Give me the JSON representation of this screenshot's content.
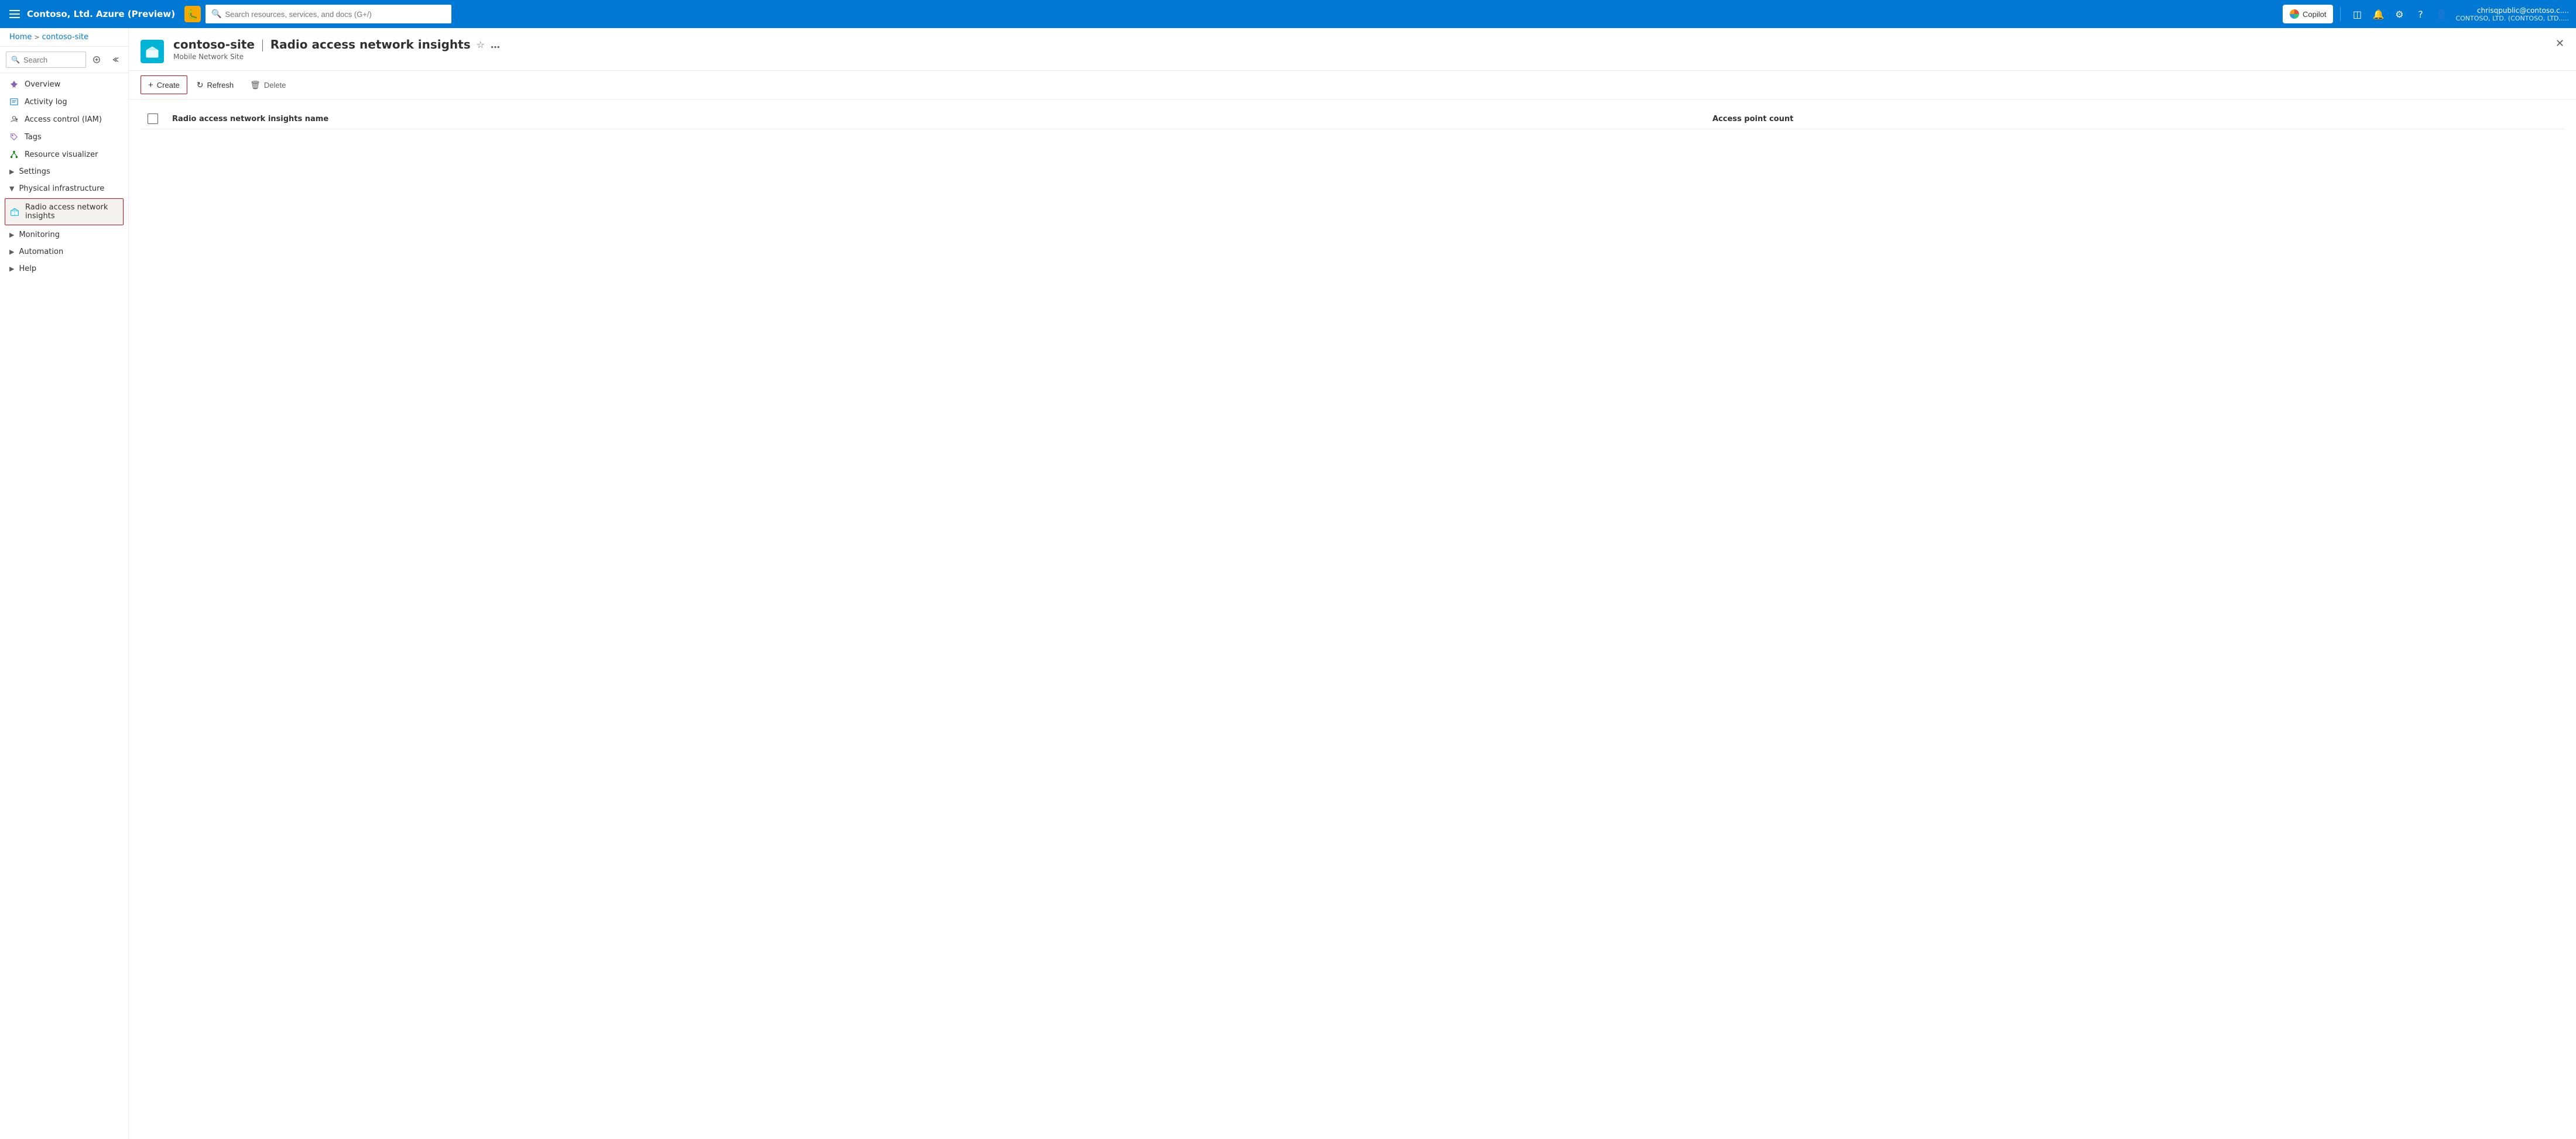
{
  "topbar": {
    "title": "Contoso, Ltd. Azure (Preview)",
    "search_placeholder": "Search resources, services, and docs (G+/)",
    "copilot_label": "Copilot",
    "user_name": "chrisqpublic@contoso.c....",
    "user_org": "CONTOSO, LTD. (CONTOSO, LTD.....",
    "close_label": "×"
  },
  "breadcrumb": {
    "home": "Home",
    "separator": ">",
    "current": "contoso-site"
  },
  "sidebar": {
    "search_placeholder": "Search",
    "items": [
      {
        "id": "overview",
        "label": "Overview",
        "icon": "pin"
      },
      {
        "id": "activity-log",
        "label": "Activity log",
        "icon": "activity"
      },
      {
        "id": "iam",
        "label": "Access control (IAM)",
        "icon": "iam"
      },
      {
        "id": "tags",
        "label": "Tags",
        "icon": "tag"
      },
      {
        "id": "resource-visualizer",
        "label": "Resource visualizer",
        "icon": "viz"
      },
      {
        "id": "settings",
        "label": "Settings",
        "expand": true
      },
      {
        "id": "physical-infra",
        "label": "Physical infrastructure",
        "expand": true,
        "expanded": true
      },
      {
        "id": "radio-access",
        "label": "Radio access network insights",
        "icon": "cube",
        "active": true
      },
      {
        "id": "monitoring",
        "label": "Monitoring",
        "expand": true
      },
      {
        "id": "automation",
        "label": "Automation",
        "expand": true
      },
      {
        "id": "help",
        "label": "Help",
        "expand": true
      }
    ]
  },
  "page": {
    "resource_name": "contoso-site",
    "page_title": "Radio access network insights",
    "subtitle": "Mobile Network Site"
  },
  "toolbar": {
    "create_label": "Create",
    "refresh_label": "Refresh",
    "delete_label": "Delete"
  },
  "table": {
    "col_checkbox": "",
    "col_name": "Radio access network insights name",
    "col_access_count": "Access point count",
    "rows": []
  }
}
